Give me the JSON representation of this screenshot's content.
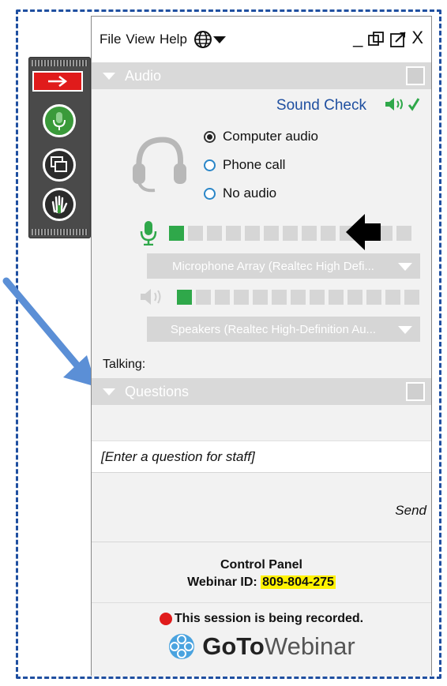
{
  "menu": {
    "file": "File",
    "view": "View",
    "help": "Help",
    "minimize": "_",
    "close": "X"
  },
  "audio": {
    "section_title": "Audio",
    "sound_check": "Sound Check",
    "options": [
      {
        "label": "Computer audio",
        "selected": true
      },
      {
        "label": "Phone call",
        "selected": false
      },
      {
        "label": "No audio",
        "selected": false
      }
    ],
    "mic_level_cells_on": 1,
    "speaker_level_cells_on": 1,
    "microphone_device": "Microphone Array (Realtec High Defi...",
    "speaker_device": "Speakers (Realtec High-Definition Au...",
    "talking_label": "Talking:"
  },
  "questions": {
    "section_title": "Questions",
    "input_placeholder": "[Enter a question for staff]",
    "send_label": "Send"
  },
  "footer": {
    "control_panel": "Control Panel",
    "webinar_id_label": "Webinar ID:",
    "webinar_id_value": "809-804-275",
    "recording_notice": "This session is being recorded.",
    "logo_goto": "GoTo",
    "logo_webinar": "Webinar"
  },
  "colors": {
    "accent_blue": "#1f4fa0",
    "mic_green": "#2fa84a",
    "record_red": "#e01b1b",
    "highlight_yellow": "#fff200",
    "section_gray": "#d9d9d9"
  },
  "icons": [
    "arrow-right-icon",
    "microphone-icon",
    "screens-icon",
    "raise-hand-icon",
    "globe-icon",
    "restore-icon",
    "popout-icon",
    "speaker-icon",
    "checkmark-icon",
    "headset-icon",
    "gotowebinar-logo-icon"
  ]
}
